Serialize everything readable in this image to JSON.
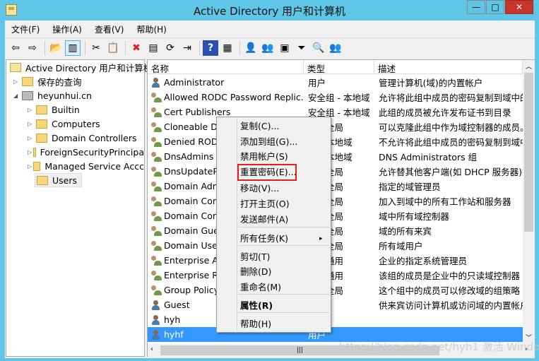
{
  "window": {
    "title": "Active Directory 用户和计算机",
    "minimize": "—",
    "maximize": "□",
    "close": "✕"
  },
  "menubar": [
    "文件(F)",
    "操作(A)",
    "查看(V)",
    "帮助(H)"
  ],
  "toolbar": [
    {
      "icon": "back-arrow-icon",
      "g": "⇦"
    },
    {
      "icon": "forward-arrow-icon",
      "g": "⇨"
    },
    {
      "sep": true
    },
    {
      "icon": "up-folder-icon",
      "g": "📂"
    },
    {
      "icon": "show-hide-tree-icon",
      "g": "▥"
    },
    {
      "sep": true
    },
    {
      "icon": "cut-icon",
      "g": "✂"
    },
    {
      "icon": "paste-icon",
      "g": "📋"
    },
    {
      "sep": true
    },
    {
      "icon": "delete-icon",
      "g": "✖"
    },
    {
      "icon": "properties-icon",
      "g": "▤"
    },
    {
      "icon": "refresh-icon",
      "g": "⟳"
    },
    {
      "icon": "export-list-icon",
      "g": "⇥"
    },
    {
      "sep": true
    },
    {
      "icon": "help-icon",
      "g": "?"
    },
    {
      "icon": "show-action-pane-icon",
      "g": "▦"
    },
    {
      "sep": true
    },
    {
      "icon": "new-user-icon",
      "g": "👤"
    },
    {
      "icon": "new-group-icon",
      "g": "👥"
    },
    {
      "icon": "new-ou-icon",
      "g": "▣"
    },
    {
      "icon": "filter-icon",
      "g": "⏷"
    },
    {
      "icon": "find-icon",
      "g": "🔍"
    },
    {
      "icon": "add-to-group-icon",
      "g": "👥"
    }
  ],
  "tree": {
    "root": "Active Directory 用户和计算机",
    "saved": "保存的查询",
    "domain": "heyunhui.cn",
    "children": [
      "Builtin",
      "Computers",
      "Domain Controllers",
      "ForeignSecurityPrincipa",
      "Managed Service Accc",
      "Users"
    ]
  },
  "columns": [
    "名称",
    "类型",
    "描述"
  ],
  "rows": [
    {
      "name": "Administrator",
      "type": "用户",
      "desc": "管理计算机(域)的内置帐户",
      "kind": "user"
    },
    {
      "name": "Allowed RODC Password Replic...",
      "type": "安全组 - 本地域",
      "desc": "允许将此组中成员的密码复制到域中的",
      "kind": "group"
    },
    {
      "name": "Cert Publishers",
      "type": "安全组 - 本地域",
      "desc": "此组的成员被允许发布证书到目录",
      "kind": "group"
    },
    {
      "name": "Cloneable Do",
      "type": "组 - 全局",
      "desc": "可以克隆此组中作为域控制器的成员。",
      "kind": "group"
    },
    {
      "name": "Denied RODC",
      "type": "组 - 本地域",
      "desc": "不允许将此组中成员的密码复制到域中",
      "kind": "group"
    },
    {
      "name": "DnsAdmins",
      "type": "组 - 本地域",
      "desc": "DNS Administrators 组",
      "kind": "group"
    },
    {
      "name": "DnsUpdatePr",
      "type": "组 - 全局",
      "desc": "允许替其他客户端(如 DHCP 服务器)执",
      "kind": "group"
    },
    {
      "name": "Domain Adm",
      "type": "组 - 全局",
      "desc": "指定的域管理员",
      "kind": "group"
    },
    {
      "name": "Domain Com",
      "type": "组 - 全局",
      "desc": "加入到域中的所有工作站和服务器",
      "kind": "group"
    },
    {
      "name": "Domain Cont",
      "type": "组 - 全局",
      "desc": "域中所有域控制器",
      "kind": "group"
    },
    {
      "name": "Domain Gues",
      "type": "组 - 全局",
      "desc": "域的所有来宾",
      "kind": "group"
    },
    {
      "name": "Domain User",
      "type": "组 - 全局",
      "desc": "所有域用户",
      "kind": "group"
    },
    {
      "name": "Enterprise Ac",
      "type": "组 - 通用",
      "desc": "企业的指定系统管理员",
      "kind": "group"
    },
    {
      "name": "Enterprise Re",
      "type": "组 - 通用",
      "desc": "该组的成员是企业中的只读域控制器",
      "kind": "group"
    },
    {
      "name": "Group Policy",
      "type": "组 - 全局",
      "desc": "这个组中的成员可以修改域的组策略",
      "kind": "group"
    },
    {
      "name": "Guest",
      "type": "",
      "desc": "供来宾访问计算机或访问域的内置帐户",
      "kind": "user"
    },
    {
      "name": "hyh",
      "type": "",
      "desc": "",
      "kind": "user"
    },
    {
      "name": "hyhf",
      "type": "用户",
      "desc": "",
      "kind": "user",
      "selected": true
    }
  ],
  "context_menu": {
    "items": [
      {
        "label": "复制(C)..."
      },
      {
        "label": "添加到组(G)..."
      },
      {
        "label": "禁用帐户(S)"
      },
      {
        "label": "重置密码(E)...",
        "highlighted": true
      },
      {
        "label": "移动(V)..."
      },
      {
        "label": "打开主页(O)"
      },
      {
        "label": "发送邮件(A)"
      },
      {
        "label": "所有任务(K)",
        "submenu": true
      },
      {
        "label": "剪切(T)"
      },
      {
        "label": "删除(D)"
      },
      {
        "label": "重命名(M)"
      },
      {
        "label": "属性(R)",
        "bold": true
      },
      {
        "label": "帮助(H)"
      }
    ],
    "submenu_arrow": "▸"
  },
  "watermark": "https://blog.csdn.net/hyh1 激活 Windo",
  "colors": {
    "titlebar": "#5fc6e8",
    "selection": "#3399ff",
    "highlight_box": "#e02020"
  }
}
